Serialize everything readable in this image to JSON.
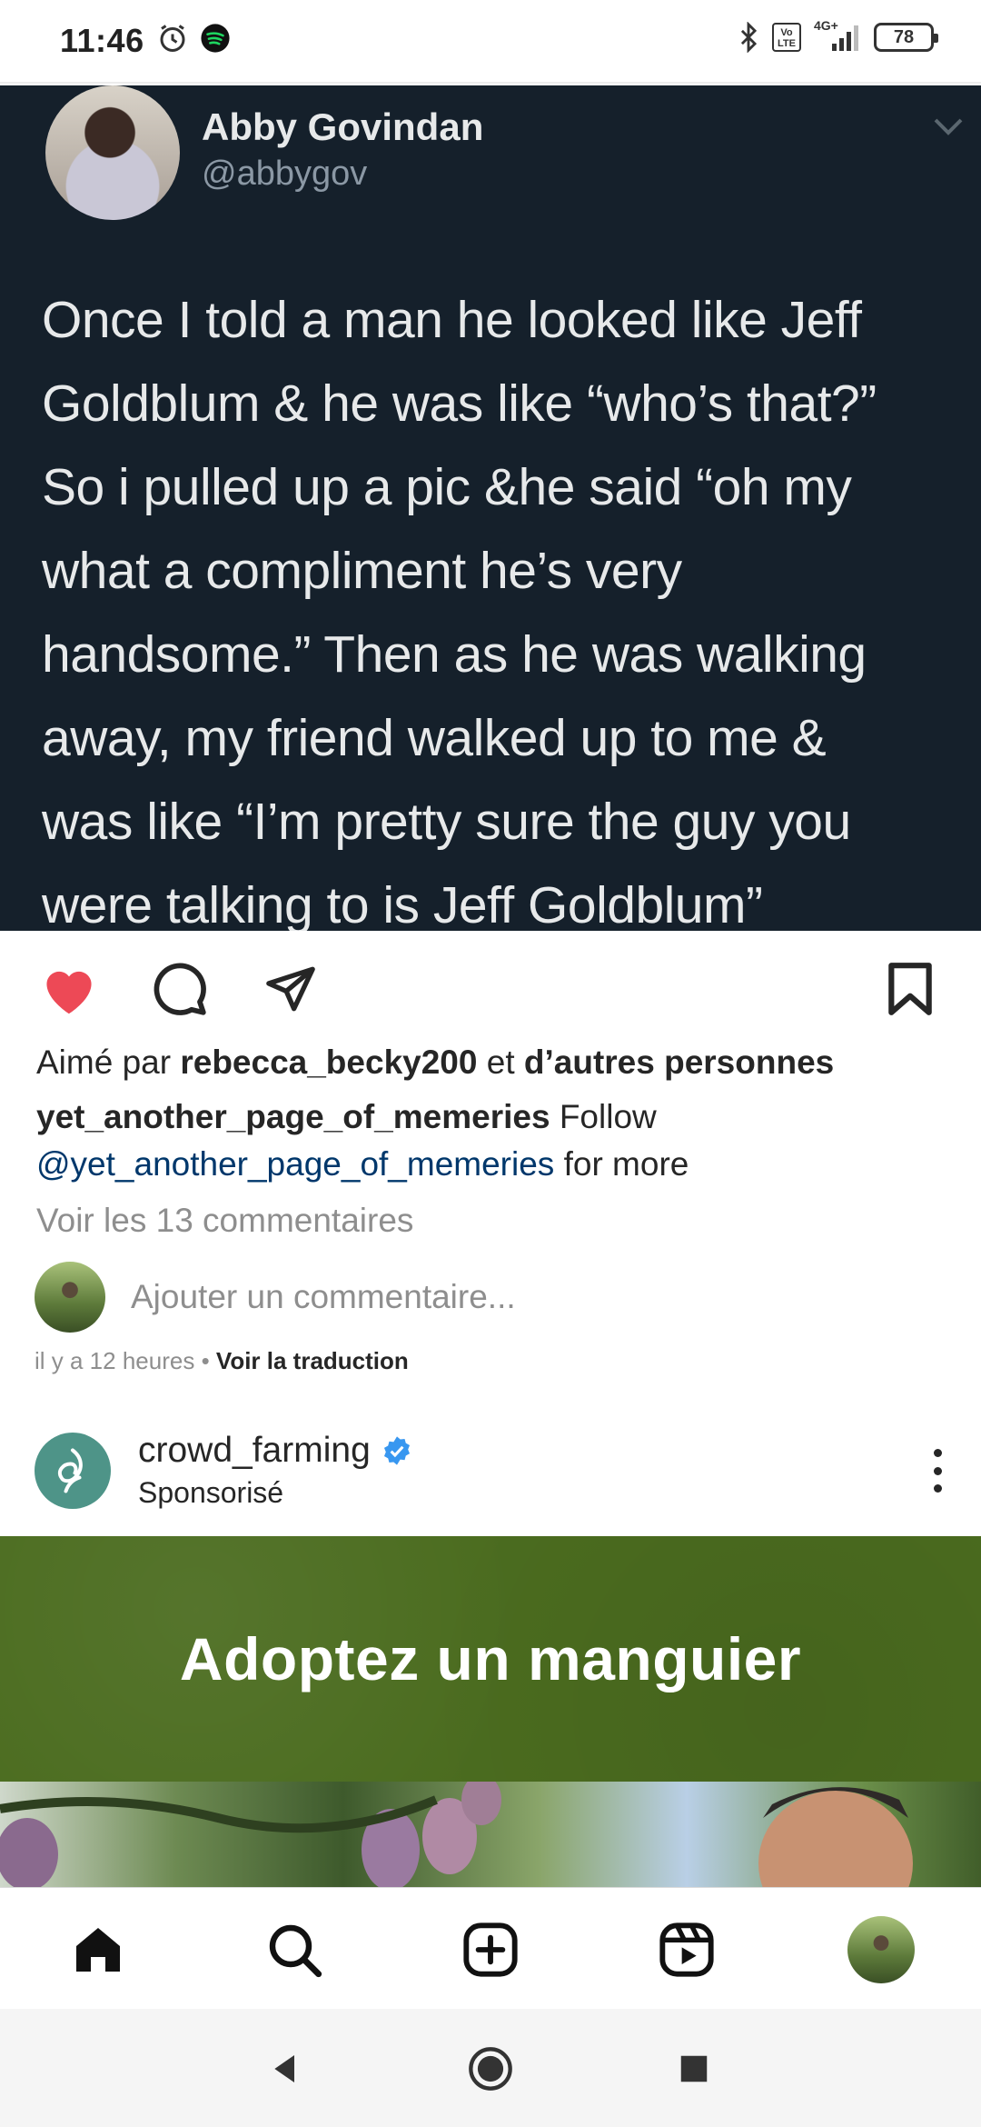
{
  "status_bar": {
    "time": "11:46",
    "network": "4G+",
    "volte": "Vo LTE",
    "battery": "78"
  },
  "tweet": {
    "name": "Abby Govindan",
    "handle": "@abbygov",
    "lines": [
      "Once I told a man he looked like Jeff",
      "Goldblum & he was like “who’s that?”",
      "So i pulled up a pic &he said “oh my",
      "what a compliment he’s very",
      "handsome.” Then as he was walking",
      "away, my friend walked up to me &",
      "was like “I’m pretty sure the guy you",
      "were talking to is Jeff Goldblum”"
    ]
  },
  "post": {
    "liked": true,
    "likes_prefix": "Aimé par",
    "likes_user": "rebecca_becky200",
    "likes_and": "et",
    "likes_others": "d’autres personnes",
    "caption_user": "yet_another_page_of_memeries",
    "caption_text": "Follow",
    "caption_mention": "@yet_another_page_of_memeries",
    "caption_tail": "for more",
    "view_comments": "Voir les 13 commentaires",
    "comment_placeholder": "Ajouter un commentaire...",
    "time_ago": "il y a 12 heures",
    "separator": "•",
    "translate": "Voir la traduction"
  },
  "sponsored": {
    "account": "crowd_farming",
    "label": "Sponsorisé",
    "ad_title": "Adoptez un manguier"
  },
  "colors": {
    "like_red": "#ed4956",
    "verified_blue": "#3897f0",
    "ad_green": "#4b6c1f",
    "mention_blue": "#00376b"
  },
  "icons": [
    "heart-icon",
    "comment-icon",
    "share-icon",
    "bookmark-icon",
    "home-icon",
    "search-icon",
    "create-icon",
    "reels-icon"
  ]
}
